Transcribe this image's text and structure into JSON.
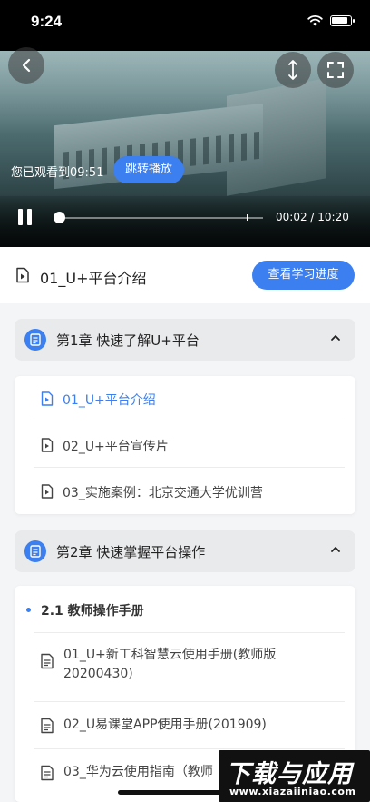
{
  "status_bar": {
    "time": "9:24"
  },
  "video": {
    "resume_text": "您已观看到09:51",
    "resume_button": "跳转播放",
    "time_display": "00:02 / 10:20",
    "progress": 0.003
  },
  "title_bar": {
    "title": "01_U+平台介绍",
    "progress_button": "查看学习进度"
  },
  "chapters": [
    {
      "title": "第1章 快速了解U+平台",
      "lessons": [
        {
          "label": "01_U+平台介绍",
          "active": true
        },
        {
          "label": "02_U+平台宣传片",
          "active": false
        },
        {
          "label": "03_实施案例：北京交通大学优训营",
          "active": false
        }
      ]
    },
    {
      "title": "第2章 快速掌握平台操作",
      "section": "2.1 教师操作手册",
      "docs": [
        {
          "label": "01_U+新工科智慧云使用手册(教师版20200430)"
        },
        {
          "label": "02_U易课堂APP使用手册(201909)"
        },
        {
          "label": "03_华为云使用指南（教师"
        }
      ]
    }
  ],
  "watermark": {
    "main": "下载与应用",
    "sub": "www.xiazaiiniao.com"
  },
  "colors": {
    "accent": "#3b7ff0",
    "chapter_bg": "#e9eaec"
  },
  "icons": [
    "wifi-icon",
    "battery-icon",
    "back-arrow-icon",
    "rotate-icon",
    "fullscreen-icon",
    "pause-icon",
    "video-file-icon",
    "chapter-doc-icon",
    "chevron-up-icon",
    "pdf-doc-icon"
  ]
}
